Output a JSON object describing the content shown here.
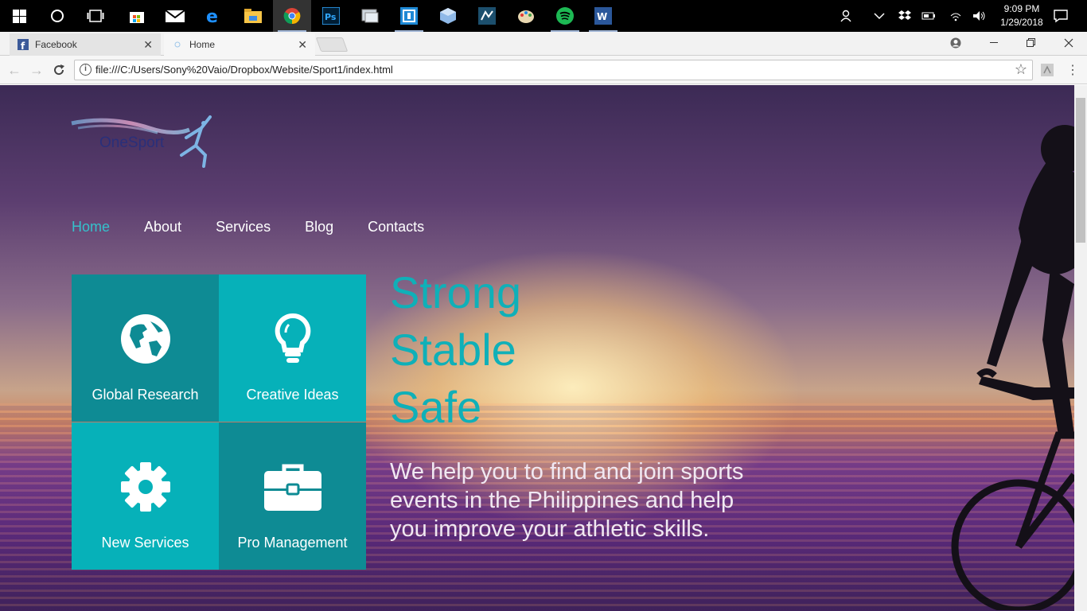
{
  "taskbar": {
    "clock_time": "9:09 PM",
    "clock_date": "1/29/2018",
    "apps": [
      "windows-start-icon",
      "cortana-icon",
      "task-view-icon",
      "store-icon",
      "mail-icon",
      "edge-icon",
      "file-explorer-icon",
      "chrome-icon",
      "photoshop-icon",
      "app-icon",
      "brackets-icon",
      "box-icon",
      "mysql-workbench-icon",
      "paint-icon",
      "spotify-icon",
      "word-icon"
    ]
  },
  "browser": {
    "tabs": [
      {
        "label": "Facebook"
      },
      {
        "label": "Home"
      }
    ],
    "address": "file:///C:/Users/Sony%20Vaio/Dropbox/Website/Sport1/index.html"
  },
  "site": {
    "logo_text": "OneSport",
    "nav": [
      {
        "label": "Home"
      },
      {
        "label": "About"
      },
      {
        "label": "Services"
      },
      {
        "label": "Blog"
      },
      {
        "label": "Contacts"
      }
    ],
    "tiles": [
      {
        "label": "Global Research",
        "icon": "globe-icon"
      },
      {
        "label": "Creative Ideas",
        "icon": "lightbulb-icon"
      },
      {
        "label": "New Services",
        "icon": "gear-icon"
      },
      {
        "label": "Pro Management",
        "icon": "briefcase-icon"
      }
    ],
    "headline": [
      "Strong",
      "Stable",
      "Safe"
    ],
    "tagline": "We help you to find and join sports events in the Philippines and help you improve your athletic skills."
  },
  "colors": {
    "accent": "#0fb0b8",
    "tile_dark": "#0e8b94",
    "tile_light": "#06b1b9",
    "nav_active": "#35c1cc"
  }
}
